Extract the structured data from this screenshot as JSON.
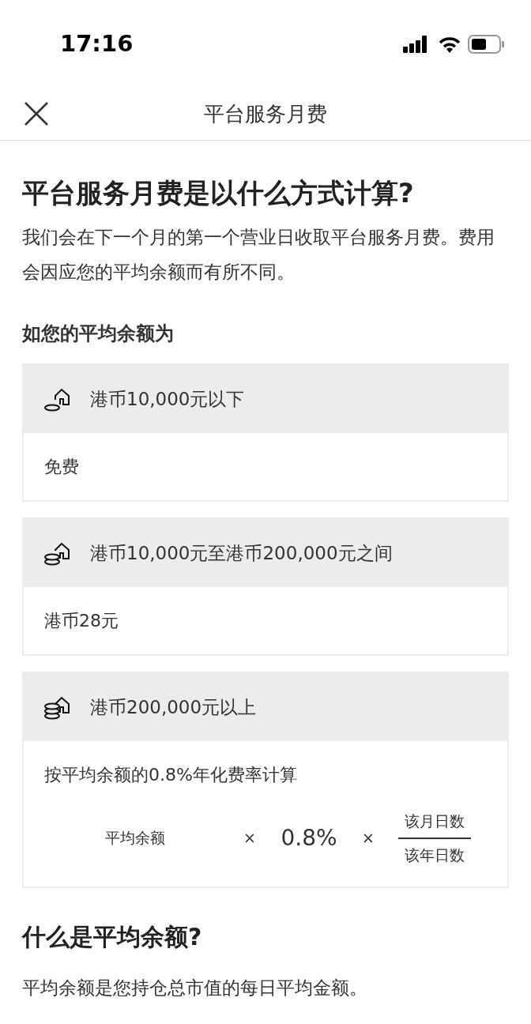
{
  "status_bar": {
    "time": "17:16"
  },
  "header": {
    "title": "平台服务月费"
  },
  "intro": {
    "heading": "平台服务月费是以什么方式计算?",
    "text": "我们会在下一个月的第一个营业日收取平台服务月费。费用会因应您的平均余额而有所不同。"
  },
  "tiers_label": "如您的平均余额为",
  "tiers": [
    {
      "kind": "small",
      "range": "港币10,000元以下",
      "fee": "免费"
    },
    {
      "kind": "medium",
      "range": "港币10,000元至港币200,000元之间",
      "fee": "港币28元"
    },
    {
      "kind": "large",
      "range": "港币200,000元以上",
      "fee": "按平均余额的0.8%年化费率计算",
      "formula": {
        "term": "平均余额",
        "times_1": "×",
        "rate": "0.8%",
        "times_2": "×",
        "numerator": "该月日数",
        "denominator": "该年日数"
      }
    }
  ],
  "faq": {
    "heading": "什么是平均余额?",
    "text": "平均余额是您持仓总市值的每日平均金额。"
  }
}
